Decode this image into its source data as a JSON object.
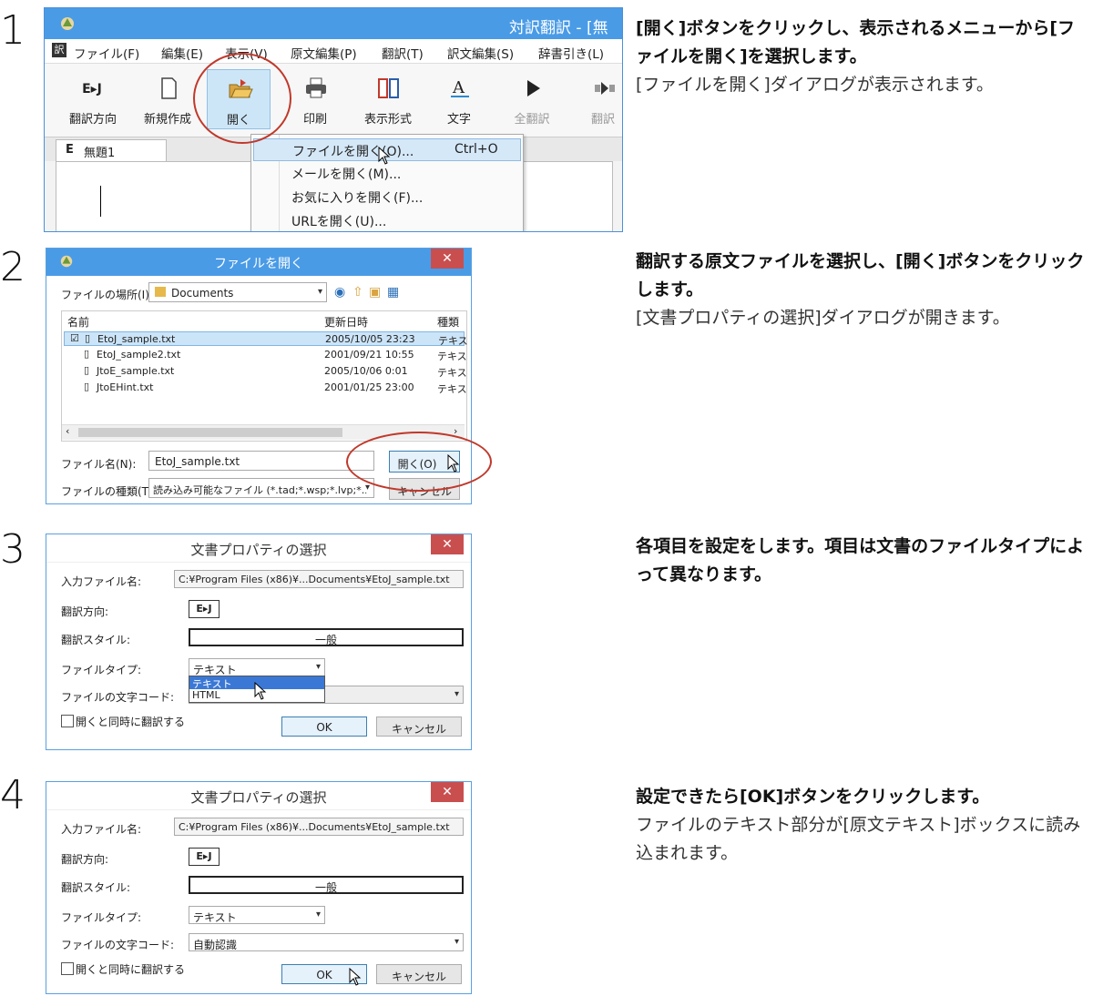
{
  "steps": [
    {
      "num": "1",
      "title": "[開く]ボタンをクリックし、表示されるメニューから[ファイルを開く]を選択します。",
      "note": "[ファイルを開く]ダイアログが表示されます。"
    },
    {
      "num": "2",
      "title": "翻訳する原文ファイルを選択し、[開く]ボタンをクリックします。",
      "note": "[文書プロパティの選択]ダイアログが開きます。"
    },
    {
      "num": "3",
      "title": "各項目を設定をします。項目は文書のファイルタイプによって異なります。",
      "note": ""
    },
    {
      "num": "4",
      "title": "設定できたら[OK]ボタンをクリックします。",
      "note": "ファイルのテキスト部分が[原文テキスト]ボックスに読み込まれます。"
    }
  ],
  "app": {
    "title": "対訳翻訳 - [無",
    "menu": [
      "ファイル(F)",
      "編集(E)",
      "表示(V)",
      "原文編集(P)",
      "翻訳(T)",
      "訳文編集(S)",
      "辞書引き(L)"
    ],
    "toolbar": [
      {
        "label": "翻訳方向",
        "icon": "translation-direction-icon"
      },
      {
        "label": "新規作成",
        "icon": "new-document-icon"
      },
      {
        "label": "開く",
        "icon": "open-folder-icon"
      },
      {
        "label": "印刷",
        "icon": "printer-icon"
      },
      {
        "label": "表示形式",
        "icon": "view-layout-icon"
      },
      {
        "label": "文字",
        "icon": "font-icon"
      },
      {
        "label": "全翻訳",
        "icon": "play-icon"
      },
      {
        "label": "翻訳",
        "icon": "translate-icon"
      }
    ],
    "direction_icon_text": "E▸J",
    "tab": "無題1",
    "tab_prefix": "E",
    "open_menu": [
      {
        "label": "ファイルを開く(O)...",
        "shortcut": "Ctrl+O"
      },
      {
        "label": "メールを開く(M)...",
        "shortcut": ""
      },
      {
        "label": "お気に入りを開く(F)...",
        "shortcut": ""
      },
      {
        "label": "URLを開く(U)...",
        "shortcut": ""
      }
    ]
  },
  "open_dialog": {
    "title": "ファイルを開く",
    "location_label": "ファイルの場所(I):",
    "location_value": "Documents",
    "columns": [
      "名前",
      "更新日時",
      "種類"
    ],
    "files": [
      {
        "name": "EtoJ_sample.txt",
        "date": "2005/10/05 23:23",
        "type": "テキス"
      },
      {
        "name": "EtoJ_sample2.txt",
        "date": "2001/09/21 10:55",
        "type": "テキス"
      },
      {
        "name": "JtoE_sample.txt",
        "date": "2005/10/06 0:01",
        "type": "テキス"
      },
      {
        "name": "JtoEHint.txt",
        "date": "2001/01/25 23:00",
        "type": "テキス"
      }
    ],
    "filename_label": "ファイル名(N):",
    "filename_value": "EtoJ_sample.txt",
    "filetype_label": "ファイルの種類(T):",
    "filetype_value": "読み込み可能なファイル (*.tad;*.wsp;*.lvp;*.l",
    "open_button": "開く(O)",
    "cancel_button": "キャンセル"
  },
  "prop_dialog": {
    "title": "文書プロパティの選択",
    "input_label": "入力ファイル名:",
    "input_value": "C:¥Program Files (x86)¥...Documents¥EtoJ_sample.txt",
    "direction_label": "翻訳方向:",
    "direction_value": "E▸J",
    "style_label": "翻訳スタイル:",
    "style_value": "一般",
    "filetype_label": "ファイルタイプ:",
    "filetype_value": "テキスト",
    "filetype_options": [
      "テキスト",
      "HTML"
    ],
    "charcode_label": "ファイルの文字コード:",
    "charcode_value": "自動認識",
    "translate_checkbox": "開くと同時に翻訳する",
    "ok_button": "OK",
    "cancel_button": "キャンセル"
  },
  "colors": {
    "titlebar": "#4a9be6",
    "highlight": "#c0392b",
    "close": "#c94f4f"
  }
}
